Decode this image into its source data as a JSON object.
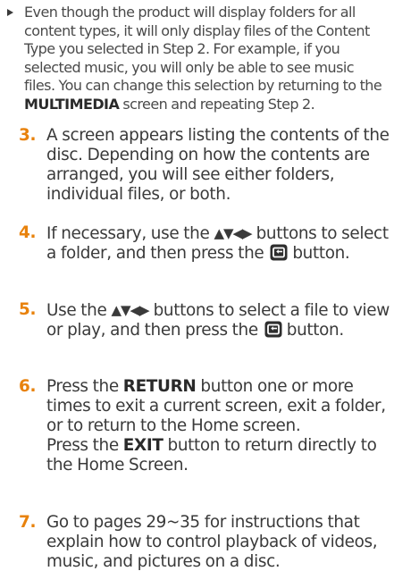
{
  "note": {
    "text_before_bold": "Even though the product will display folders for all content types, it will only display files of the Content Type you selected in Step 2. For example, if you selected music, you will only be able to see music files. You can change this selection by returning to the ",
    "bold": "MULTIMEDIA",
    "text_after_bold": " screen and repeating Step 2."
  },
  "steps": [
    {
      "number": "3.",
      "text": "A screen appears listing the contents of the disc. Depending on how the contents are arranged, you will see either folders, individual files, or both."
    },
    {
      "number": "4.",
      "text_before_arrows": "If necessary, use the ",
      "arrows": "▲▼◀▶",
      "text_after_arrows": " buttons to select a folder, and then press the ",
      "text_after_icon": " button."
    },
    {
      "number": "5.",
      "text_before_arrows": "Use the ",
      "arrows": "▲▼◀▶",
      "text_after_arrows": " buttons to select a file to view or play, and then press the ",
      "text_after_icon": " button."
    },
    {
      "number": "6.",
      "line1_before_bold": "Press the ",
      "line1_bold": "RETURN",
      "line1_after_bold": " button one or more times to exit a current screen, exit a folder, or to return to the Home screen.",
      "line2_before_bold": "Press the ",
      "line2_bold": "EXIT",
      "line2_after_bold": " button to return directly to the Home Screen."
    },
    {
      "number": "7.",
      "text": "Go to pages 29~35 for instructions that explain how to control playback of videos, music, and pictures on a disc."
    }
  ],
  "colors": {
    "step_number": "#e8820c",
    "body_text": "#3a3a3a",
    "note_text": "#4a4a4a"
  },
  "icons": {
    "enter_button": "enter-button-icon",
    "note_marker": "triangle-bullet-icon"
  }
}
